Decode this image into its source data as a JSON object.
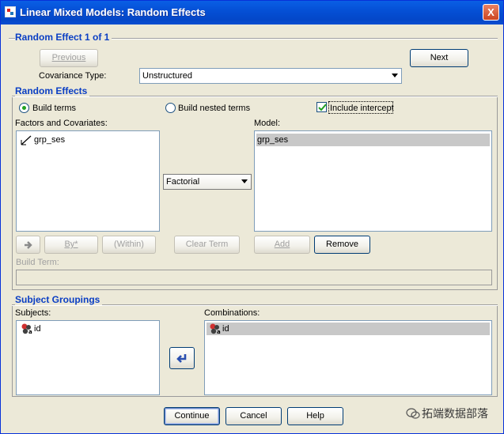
{
  "window": {
    "title": "Linear Mixed Models: Random Effects",
    "close_label": "X"
  },
  "random_effect": {
    "group_title": "Random Effect 1 of 1",
    "previous_label": "Previous",
    "next_label": "Next",
    "covariance_label": "Covariance Type:",
    "covariance_value": "Unstructured"
  },
  "random_effects": {
    "group_title": "Random Effects",
    "build_terms_label": "Build terms",
    "build_nested_label": "Build nested terms",
    "include_intercept_label": "Include intercept",
    "include_intercept_checked": true,
    "factors_label": "Factors and Covariates:",
    "factors": [
      "grp_ses"
    ],
    "model_label": "Model:",
    "model": [
      "grp_ses"
    ],
    "factorial_value": "Factorial",
    "by_label": "By*",
    "within_label": "(Within)",
    "clear_term_label": "Clear Term",
    "add_label": "Add",
    "remove_label": "Remove",
    "build_term_label": "Build Term:",
    "build_term_value": ""
  },
  "subject_groupings": {
    "group_title": "Subject Groupings",
    "subjects_label": "Subjects:",
    "subjects": [
      "id"
    ],
    "combinations_label": "Combinations:",
    "combinations": [
      "id"
    ]
  },
  "footer": {
    "continue_label": "Continue",
    "cancel_label": "Cancel",
    "help_label": "Help"
  },
  "watermark": {
    "text": "拓端数据部落"
  },
  "colors": {
    "title_bar": "#0550d6",
    "group_title": "#0a3ec4",
    "dialog_bg": "#ece9d8",
    "selection": "#c8c8c8"
  },
  "icons": {
    "scale_variable": "scale-variable-icon",
    "nominal_variable": "nominal-variable-icon",
    "move": "arrow-right-icon",
    "move_back": "arrow-left-icon"
  }
}
